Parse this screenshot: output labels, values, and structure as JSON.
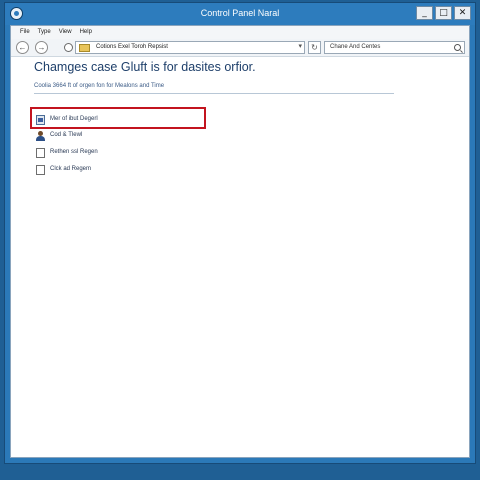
{
  "window": {
    "title": "Control Panel Naral",
    "controls": [
      "_",
      "□",
      "✕"
    ]
  },
  "menu": [
    "File",
    "Type",
    "View",
    "Help"
  ],
  "nav": {
    "back": "←",
    "forward": "→",
    "address": "Cotions Exel Toroh Repsist",
    "address_arrow": "▾",
    "refresh": "↻",
    "search_text": "Chane And Centes"
  },
  "content": {
    "heading": "Chamges case Gluft is for dasites orfior.",
    "subheading": "Coolia 3664 ft of orgen fon for Mealons and Time",
    "options": [
      {
        "label": "Mer of ibut Degerl",
        "icon": "image-icon"
      },
      {
        "label": "Cod & Tlewl",
        "icon": "user-icon"
      },
      {
        "label": "Rethen ssl Regen",
        "icon": "checkbox-icon"
      },
      {
        "label": "Clck ad Regem",
        "icon": "checkbox-icon"
      }
    ]
  },
  "colors": {
    "titlebar": "#2d7cbd",
    "highlight": "#c3141f",
    "heading": "#1e3f6a"
  }
}
